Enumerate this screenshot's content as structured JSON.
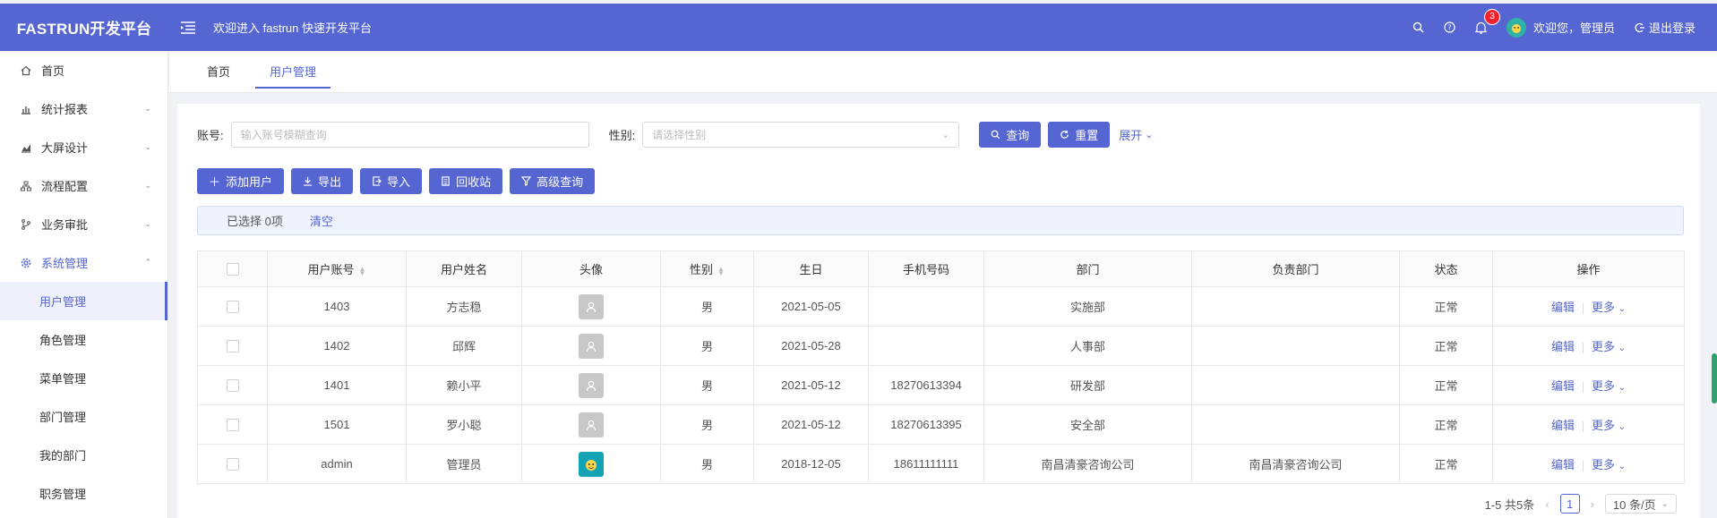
{
  "header": {
    "logo": "FASTRUN开发平台",
    "welcome": "欢迎进入 fastrun 快速开发平台",
    "notification_count": "3",
    "user_greeting": "欢迎您，管理员",
    "logout": "退出登录",
    "bg_color": "#5565d1"
  },
  "sidebar": {
    "items": [
      {
        "label": "首页",
        "icon": "home-icon"
      },
      {
        "label": "统计报表",
        "icon": "bar-chart-icon"
      },
      {
        "label": "大屏设计",
        "icon": "area-chart-icon"
      },
      {
        "label": "流程配置",
        "icon": "flow-icon"
      },
      {
        "label": "业务审批",
        "icon": "branch-icon"
      },
      {
        "label": "系统管理",
        "icon": "gear-icon"
      }
    ],
    "sub_items": [
      "用户管理",
      "角色管理",
      "菜单管理",
      "部门管理",
      "我的部门",
      "职务管理"
    ]
  },
  "tabs": [
    "首页",
    "用户管理"
  ],
  "search": {
    "account_label": "账号:",
    "account_placeholder": "输入账号模糊查询",
    "gender_label": "性别:",
    "gender_placeholder": "请选择性别",
    "query_btn": "查询",
    "reset_btn": "重置",
    "expand": "展开"
  },
  "actions": {
    "add": "添加用户",
    "export": "导出",
    "import": "导入",
    "recycle": "回收站",
    "advanced": "高级查询"
  },
  "selection": {
    "text": "已选择 0项",
    "clear": "清空"
  },
  "table": {
    "columns": [
      "用户账号",
      "用户姓名",
      "头像",
      "性别",
      "生日",
      "手机号码",
      "部门",
      "负责部门",
      "状态",
      "操作"
    ],
    "rows": [
      {
        "account": "1403",
        "name": "方志稳",
        "gender": "男",
        "birthday": "2021-05-05",
        "phone": "",
        "dept": "实施部",
        "resp_dept": "",
        "status": "正常"
      },
      {
        "account": "1402",
        "name": "邱辉",
        "gender": "男",
        "birthday": "2021-05-28",
        "phone": "",
        "dept": "人事部",
        "resp_dept": "",
        "status": "正常"
      },
      {
        "account": "1401",
        "name": "赖小平",
        "gender": "男",
        "birthday": "2021-05-12",
        "phone": "18270613394",
        "dept": "研发部",
        "resp_dept": "",
        "status": "正常"
      },
      {
        "account": "1501",
        "name": "罗小聪",
        "gender": "男",
        "birthday": "2021-05-12",
        "phone": "18270613395",
        "dept": "安全部",
        "resp_dept": "",
        "status": "正常"
      },
      {
        "account": "admin",
        "name": "管理员",
        "gender": "男",
        "birthday": "2018-12-05",
        "phone": "18611111111",
        "dept": "南昌清豪咨询公司",
        "resp_dept": "南昌清豪咨询公司",
        "status": "正常"
      }
    ],
    "edit": "编辑",
    "more": "更多"
  },
  "pager": {
    "summary": "1-5 共5条",
    "current": "1",
    "size": "10 条/页"
  }
}
